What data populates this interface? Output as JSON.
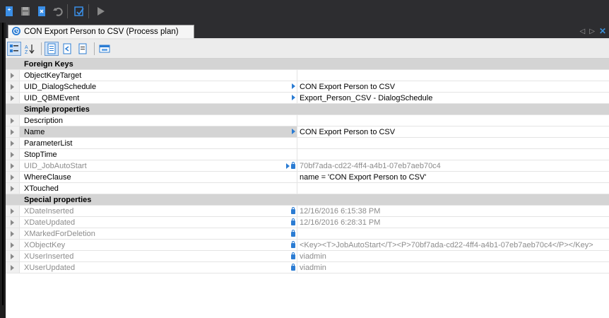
{
  "document": {
    "tab_title": "CON Export Person to CSV (Process plan)"
  },
  "sections": [
    {
      "title": "Foreign Keys",
      "rows": [
        {
          "name": "ObjectKeyTarget",
          "value": "",
          "ref": false,
          "lock": false,
          "readonly": false,
          "selected": false
        },
        {
          "name": "UID_DialogSchedule",
          "value": "CON Export Person to CSV",
          "ref": true,
          "lock": false,
          "readonly": false,
          "selected": false
        },
        {
          "name": "UID_QBMEvent",
          "value": "Export_Person_CSV - DialogSchedule",
          "ref": true,
          "lock": false,
          "readonly": false,
          "selected": false
        }
      ]
    },
    {
      "title": "Simple properties",
      "rows": [
        {
          "name": "Description",
          "value": "",
          "ref": false,
          "lock": false,
          "readonly": false,
          "selected": false
        },
        {
          "name": "Name",
          "value": "CON Export Person to CSV",
          "ref": true,
          "lock": false,
          "readonly": false,
          "selected": true
        },
        {
          "name": "ParameterList",
          "value": "",
          "ref": false,
          "lock": false,
          "readonly": false,
          "selected": false
        },
        {
          "name": "StopTime",
          "value": "",
          "ref": false,
          "lock": false,
          "readonly": false,
          "selected": false
        },
        {
          "name": "UID_JobAutoStart",
          "value": "70bf7ada-cd22-4ff4-a4b1-07eb7aeb70c4",
          "ref": true,
          "lock": true,
          "readonly": true,
          "selected": false
        },
        {
          "name": "WhereClause",
          "value": "name = 'CON Export Person to CSV'",
          "ref": false,
          "lock": false,
          "readonly": false,
          "selected": false
        },
        {
          "name": "XTouched",
          "value": "",
          "ref": false,
          "lock": false,
          "readonly": false,
          "selected": false
        }
      ]
    },
    {
      "title": "Special properties",
      "rows": [
        {
          "name": "XDateInserted",
          "value": "12/16/2016 6:15:38 PM",
          "ref": false,
          "lock": true,
          "readonly": true,
          "selected": false
        },
        {
          "name": "XDateUpdated",
          "value": "12/16/2016 6:28:31 PM",
          "ref": false,
          "lock": true,
          "readonly": true,
          "selected": false
        },
        {
          "name": "XMarkedForDeletion",
          "value": "",
          "ref": false,
          "lock": true,
          "readonly": true,
          "selected": false
        },
        {
          "name": "XObjectKey",
          "value": "<Key><T>JobAutoStart</T><P>70bf7ada-cd22-4ff4-a4b1-07eb7aeb70c4</P></Key>",
          "ref": false,
          "lock": true,
          "readonly": true,
          "selected": false
        },
        {
          "name": "XUserInserted",
          "value": "viadmin",
          "ref": false,
          "lock": true,
          "readonly": true,
          "selected": false
        },
        {
          "name": "XUserUpdated",
          "value": "viadmin",
          "ref": false,
          "lock": true,
          "readonly": true,
          "selected": false
        }
      ]
    }
  ],
  "colors": {
    "accent": "#2b7cd3",
    "category_band": "#d4d4d4",
    "readonly_text": "#8c8c8c",
    "frame": "#2d2d30"
  },
  "icons": {
    "main_toolbar": [
      "new-icon",
      "save-icon",
      "delete-icon",
      "undo-icon",
      "edit-icon",
      "run-icon"
    ],
    "property_toolbar": [
      "categorized-icon",
      "sort-az-icon",
      "properties-icon",
      "tasks-icon",
      "document-icon",
      "view-icon"
    ]
  }
}
